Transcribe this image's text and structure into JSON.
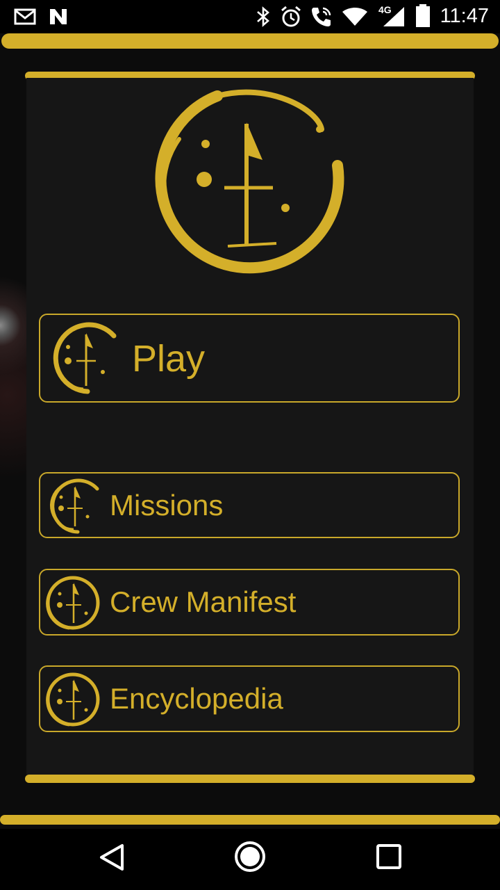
{
  "status_bar": {
    "time": "11:47",
    "network": "4G",
    "icons": [
      "gmail-icon",
      "n-icon",
      "bluetooth-icon",
      "alarm-icon",
      "call-icon",
      "wifi-icon",
      "signal-icon",
      "battery-icon"
    ]
  },
  "colors": {
    "accent": "#d4af2a",
    "panel": "#161616",
    "background": "#0c0c0c"
  },
  "logo": {
    "icon": "crescent-emblem-icon"
  },
  "menu": {
    "play": "Play",
    "missions": "Missions",
    "crew_manifest": "Crew Manifest",
    "encyclopedia": "Encyclopedia"
  },
  "nav_bar": {
    "icons": [
      "back-icon",
      "home-icon",
      "recents-icon"
    ]
  }
}
